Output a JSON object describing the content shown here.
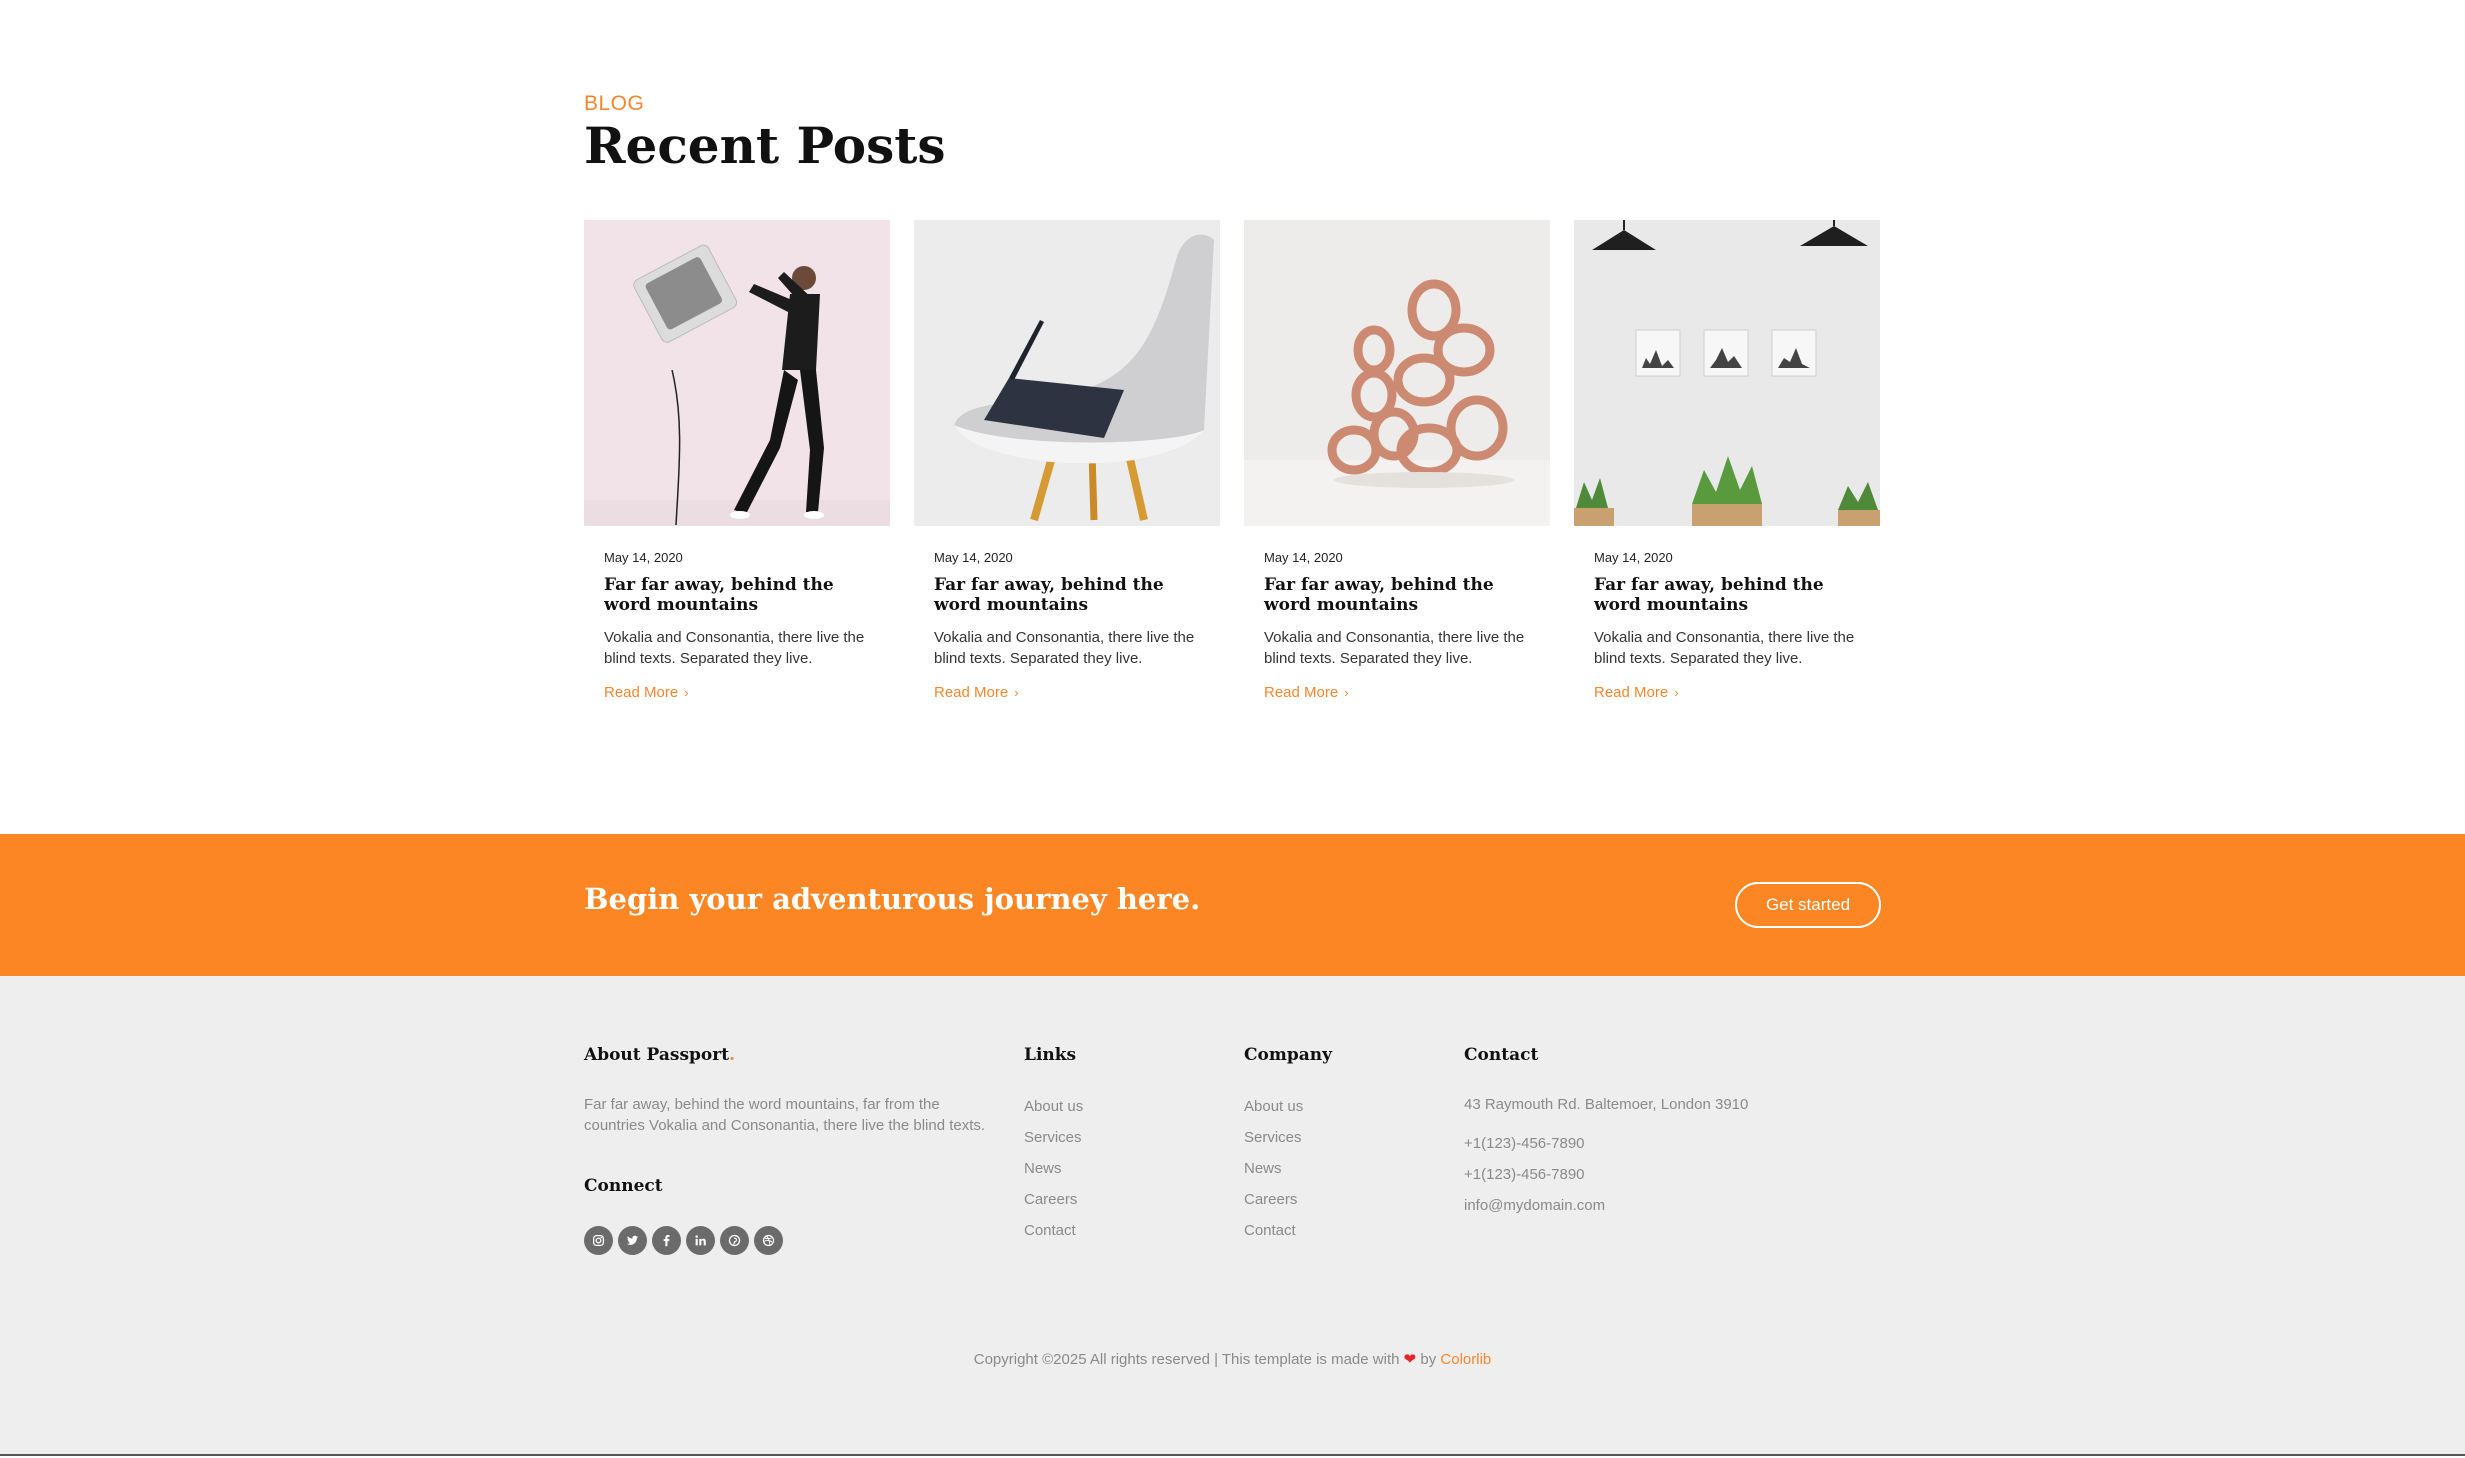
{
  "blog": {
    "eyebrow": "BLOG",
    "title": "Recent Posts",
    "read_more_label": "Read More",
    "posts": [
      {
        "date": "May 14, 2020",
        "title": "Far far away, behind the word mountains",
        "excerpt": "Vokalia and Consonantia, there live the blind texts. Separated they live.",
        "read_more": "Read More",
        "image": "man-carrying-tv"
      },
      {
        "date": "May 14, 2020",
        "title": "Far far away, behind the word mountains",
        "excerpt": "Vokalia and Consonantia, there live the blind texts. Separated they live.",
        "read_more": "Read More",
        "image": "laptop-on-chair"
      },
      {
        "date": "May 14, 2020",
        "title": "Far far away, behind the word mountains",
        "excerpt": "Vokalia and Consonantia, there live the blind texts. Separated they live.",
        "read_more": "Read More",
        "image": "paper-sculpture"
      },
      {
        "date": "May 14, 2020",
        "title": "Far far away, behind the word mountains",
        "excerpt": "Vokalia and Consonantia, there live the blind texts. Separated they live.",
        "read_more": "Read More",
        "image": "wall-frames-plants"
      }
    ]
  },
  "cta": {
    "title": "Begin your adventurous journey here.",
    "button": "Get started"
  },
  "footer": {
    "about": {
      "title": "About Passport",
      "title_dot": ".",
      "text": "Far far away, behind the word mountains, far from the countries Vokalia and Consonantia, there live the blind texts."
    },
    "connect": {
      "title": "Connect",
      "icons": [
        "instagram-icon",
        "twitter-icon",
        "facebook-icon",
        "linkedin-icon",
        "pinterest-icon",
        "dribbble-icon"
      ]
    },
    "links": {
      "title": "Links",
      "items": [
        "About us",
        "Services",
        "News",
        "Careers",
        "Contact"
      ]
    },
    "company": {
      "title": "Company",
      "items": [
        "About us",
        "Services",
        "News",
        "Careers",
        "Contact"
      ]
    },
    "contact": {
      "title": "Contact",
      "address": "43 Raymouth Rd. Baltemoer, London 3910",
      "items": [
        "+1(123)-456-7890",
        "+1(123)-456-7890",
        "info@mydomain.com"
      ]
    },
    "copyright": {
      "prefix": "Copyright ©2025 All rights reserved | This template is made with",
      "by": "by",
      "brand": "Colorlib"
    }
  },
  "colors": {
    "accent": "#fb8623",
    "accent_text": "#f6862d",
    "footer_bg": "#eeeeee",
    "heart": "#e8222b"
  }
}
